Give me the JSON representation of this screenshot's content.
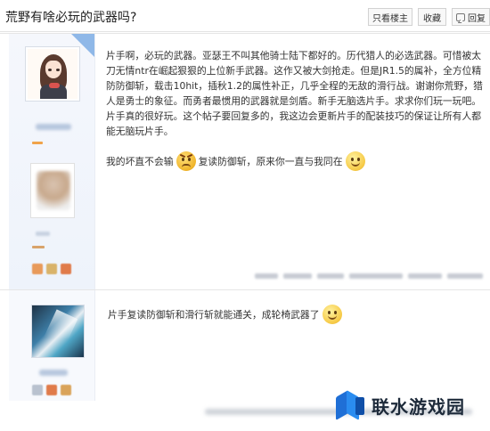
{
  "header": {
    "title": "荒野有啥必玩的武器吗?",
    "only_louzhu_label": "只看楼主",
    "favorite_label": "收藏",
    "reply_label": "回复"
  },
  "posts": [
    {
      "paragraph": "片手啊，必玩的武器。亚瑟王不叫其他骑士陆下都好的。历代猎人的必选武器。可惜被太刀无情ntr在崛起狠狠的上位新手武器。这作又被大剑抢走。但是JR1.5的属补，全方位精防防御斩，载击10hit，插秋1.2的属性补正，几乎全程的无敌的滑行战。谢谢你荒野，猎人是勇士的象征。而勇者最惯用的武器就是剑盾。新手无脑选片手。求求你们玩一玩吧。片手真的很好玩。这个帖子要回复多的，我这边会更新片手的配装技巧的保证让所有人都能无脑玩片手。",
      "line_a": "我的坏直不会输",
      "line_b": "复读防御斩，原来你一直与我同在",
      "emoji_1": "angry-face-icon",
      "emoji_2": "smile-face-icon"
    },
    {
      "text": "片手复读防御斩和滑行斩就能通关，成轮椅武器了",
      "emoji": "smile-face-icon"
    }
  ],
  "watermark": {
    "text": "联水游戏园"
  },
  "colors": {
    "accent": "#8fb8e8",
    "sidebar": "#f5f7fc"
  }
}
